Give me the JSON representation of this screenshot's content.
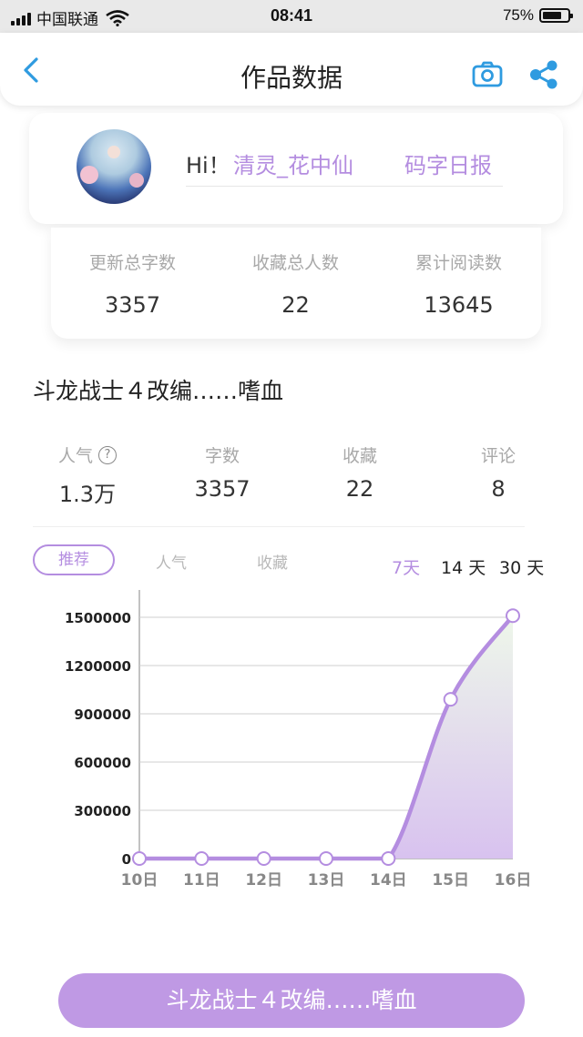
{
  "status_bar": {
    "carrier": "中国联通",
    "time": "08:41",
    "battery": "75%",
    "battery_level": 0.75
  },
  "header": {
    "title": "作品数据"
  },
  "user": {
    "greeting": "Hi！",
    "name": "清灵_花中仙",
    "report_link": "码字日报"
  },
  "totals": [
    {
      "label": "更新总字数",
      "value": "3357"
    },
    {
      "label": "收藏总人数",
      "value": "22"
    },
    {
      "label": "累计阅读数",
      "value": "13645"
    }
  ],
  "work": {
    "title": "斗龙战士４改编……嗜血"
  },
  "metrics": [
    {
      "label": "人气",
      "value": "1.3万",
      "help": "?"
    },
    {
      "label": "字数",
      "value": "3357"
    },
    {
      "label": "收藏",
      "value": "22"
    },
    {
      "label": "评论",
      "value": "8"
    }
  ],
  "tabs": [
    {
      "label": "推荐"
    },
    {
      "label": "人气"
    },
    {
      "label": "收藏"
    }
  ],
  "ranges": [
    {
      "label": "7天"
    },
    {
      "label": "14 天"
    },
    {
      "label": "30 天"
    }
  ],
  "colors": {
    "accent": "#b48de0",
    "button": "#bf99e4"
  },
  "chart_data": {
    "type": "area",
    "x": [
      "10日",
      "11日",
      "12日",
      "13日",
      "14日",
      "15日",
      "16日"
    ],
    "values": [
      0,
      0,
      0,
      0,
      0,
      990000,
      1510000
    ],
    "yticks": [
      "0",
      "300000",
      "600000",
      "900000",
      "1200000",
      "1500000"
    ],
    "ylim": [
      0,
      1500000
    ],
    "grid": true
  },
  "bottom_button": {
    "label": "斗龙战士４改编……嗜血"
  }
}
